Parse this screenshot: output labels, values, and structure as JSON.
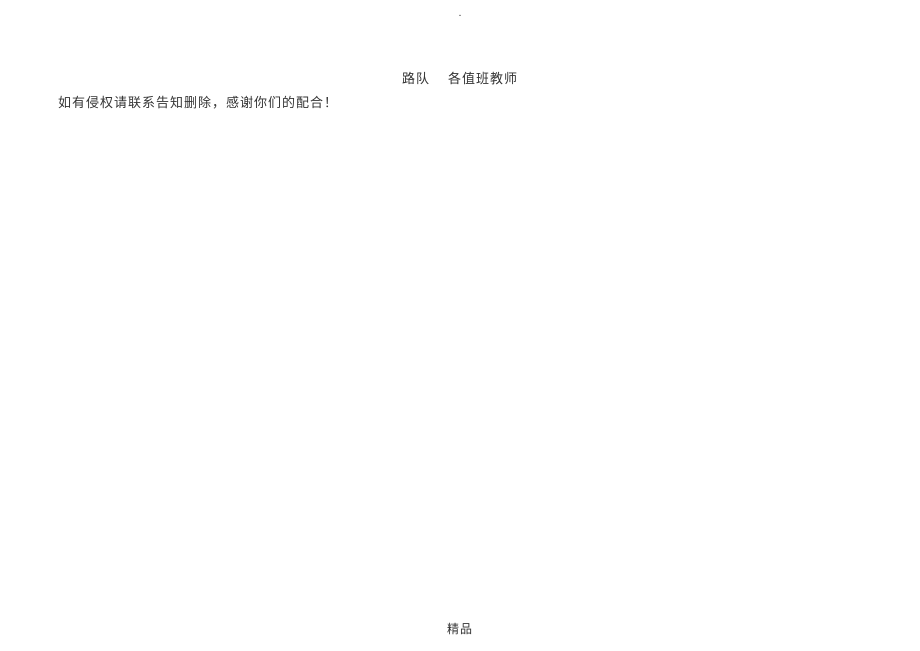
{
  "header": {
    "marker": "."
  },
  "body": {
    "line1_part1": "路队",
    "line1_part2": "各值班教师",
    "line2": "如有侵权请联系告知删除，感谢你们的配合！"
  },
  "footer": {
    "text": "精品"
  }
}
